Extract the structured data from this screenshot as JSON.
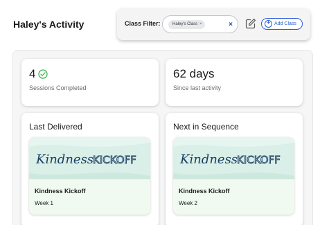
{
  "header": {
    "title": "Haley's Activity"
  },
  "filter": {
    "label": "Class Filter:",
    "selected_chip": "Haley's Class",
    "chip_remove": "×",
    "clear": "×",
    "add_button": "Add Class"
  },
  "stats": [
    {
      "value": "4",
      "label": "Sessions Completed",
      "icon": "check-circle-icon"
    },
    {
      "value": "62 days",
      "label": "Since last activity"
    }
  ],
  "last_delivered": {
    "heading": "Last Delivered",
    "lesson": "Kindness Kickoff",
    "week": "Week 1",
    "banner_word1": "Kindness",
    "banner_word2": "KICKOFF"
  },
  "next_in_sequence": {
    "heading": "Next in Sequence",
    "lesson": "Kindness Kickoff",
    "week": "Week 2",
    "banner_word1": "Kindness",
    "banner_word2": "KICKOFF"
  },
  "colors": {
    "accent": "#2a5bd7",
    "check_green": "#3bb54a",
    "banner_bg": "#d9efe7",
    "banner_text": "#1d3f64",
    "lesson_bg": "#f0faf0"
  }
}
